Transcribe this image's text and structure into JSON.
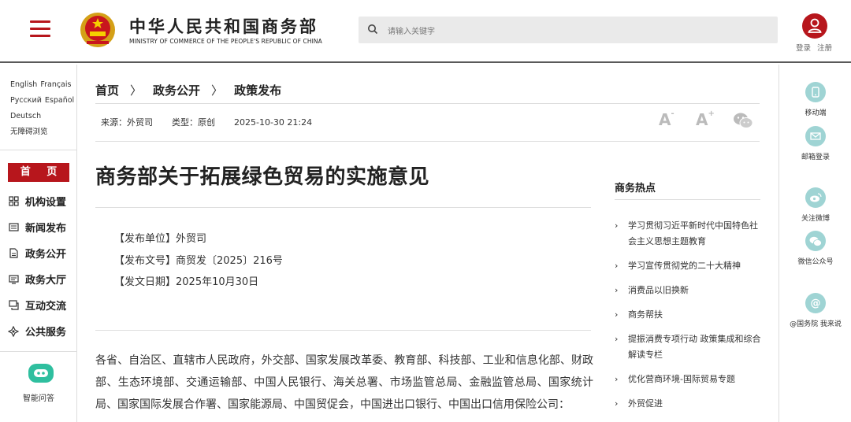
{
  "header": {
    "logo_cn": "中华人民共和国商务部",
    "logo_en": "MINISTRY OF COMMERCE OF THE PEOPLE'S REPUBLIC OF CHINA",
    "search_placeholder": "请输入关键字",
    "login": "登录",
    "register": "注册"
  },
  "left_sidebar": {
    "languages": [
      "English",
      "Français",
      "Русский",
      "Español",
      "Deutsch",
      "无障碍浏览"
    ],
    "nav_home": "首 页",
    "nav_items": [
      {
        "label": "机构设置",
        "icon": "org-grid-icon"
      },
      {
        "label": "新闻发布",
        "icon": "news-icon"
      },
      {
        "label": "政务公开",
        "icon": "document-icon"
      },
      {
        "label": "政务大厅",
        "icon": "hall-icon"
      },
      {
        "label": "互动交流",
        "icon": "interact-icon"
      },
      {
        "label": "公共服务",
        "icon": "service-icon"
      }
    ],
    "assistant_label": "智能问答"
  },
  "breadcrumb": [
    "首页",
    "政务公开",
    "政策发布"
  ],
  "meta": {
    "source": "来源：外贸司",
    "type": "类型：原创",
    "datetime": "2025-10-30 21:24",
    "font_small": "A",
    "font_large": "A"
  },
  "article": {
    "title": "商务部关于拓展绿色贸易的实施意见",
    "issuer": "【发布单位】外贸司",
    "doc_number": "【发布文号】商贸发〔2025〕216号",
    "issue_date": "【发文日期】2025年10月30日",
    "body": "各省、自治区、直辖市人民政府，外交部、国家发展改革委、教育部、科技部、工业和信息化部、财政部、生态环境部、交通运输部、中国人民银行、海关总署、市场监管总局、金融监管总局、国家统计局、国家国际发展合作署、国家能源局、中国贸促会，中国进出口银行、中国出口信用保险公司："
  },
  "hot_topics": {
    "title": "商务热点",
    "items": [
      "学习贯彻习近平新时代中国特色社会主义思想主题教育",
      "学习宣传贯彻党的二十大精神",
      "消费品以旧换新",
      "商务帮扶",
      "提振消费专项行动 政策集成和综合解读专栏",
      "优化营商环境-国际贸易专题",
      "外贸促进"
    ]
  },
  "right_sidebar": [
    {
      "label": "移动端",
      "icon": "mobile-icon"
    },
    {
      "label": "邮箱登录",
      "icon": "mail-icon"
    },
    {
      "label": "关注微博",
      "icon": "weibo-icon"
    },
    {
      "label": "微信公众号",
      "icon": "wechat-icon"
    },
    {
      "label": "@国务院 我来说",
      "icon": "at-icon",
      "glyph": "@"
    }
  ],
  "colors": {
    "brand_red": "#b7161c",
    "accent_teal": "#9fd4d4"
  }
}
